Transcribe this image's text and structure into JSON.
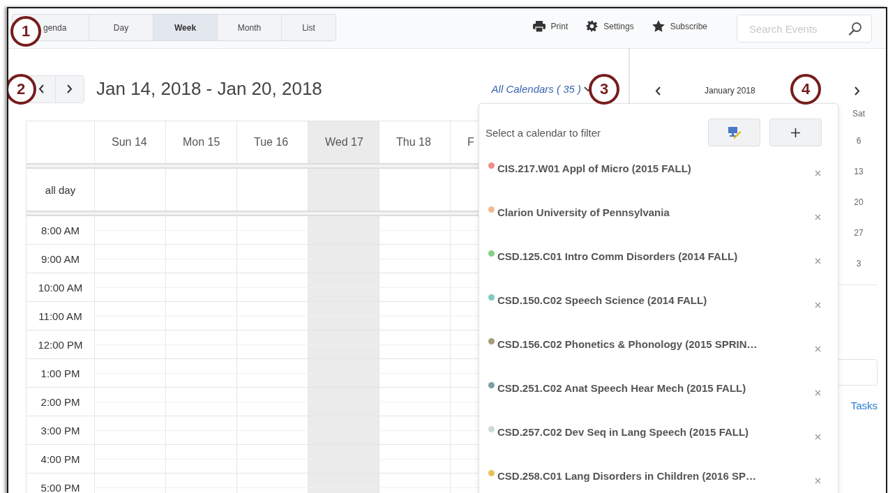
{
  "toolbar": {
    "view_tabs": [
      {
        "label": "genda",
        "selected": false
      },
      {
        "label": "Day",
        "selected": false
      },
      {
        "label": "Week",
        "selected": true
      },
      {
        "label": "Month",
        "selected": false
      },
      {
        "label": "List",
        "selected": false
      }
    ],
    "actions": [
      {
        "kind": "print",
        "label": "Print"
      },
      {
        "kind": "settings",
        "label": "Settings"
      },
      {
        "kind": "subscribe",
        "label": "Subscribe"
      }
    ],
    "search": {
      "placeholder": "Search Events"
    }
  },
  "week_view": {
    "date_range": "Jan 14, 2018 - Jan 20, 2018",
    "calendar_filter": "All Calendars ( 35 )",
    "all_day_label": "all day",
    "days": [
      {
        "label": "Sun 14",
        "highlighted": false
      },
      {
        "label": "Mon 15",
        "highlighted": false
      },
      {
        "label": "Tue 16",
        "highlighted": false
      },
      {
        "label": "Wed 17",
        "highlighted": true
      },
      {
        "label": "Thu 18",
        "highlighted": false
      },
      {
        "label": "F",
        "highlighted": false
      }
    ],
    "hours": [
      "8:00 AM",
      "9:00 AM",
      "10:00 AM",
      "11:00 AM",
      "12:00 PM",
      "1:00 PM",
      "2:00 PM",
      "3:00 PM",
      "4:00 PM",
      "5:00 PM"
    ]
  },
  "mini_calendar": {
    "month": "January 2018",
    "weekday": "Sat",
    "dates": [
      "6",
      "13",
      "20",
      "27",
      "3"
    ]
  },
  "sidebar_link": "Tasks",
  "calendar_dropdown": {
    "prompt": "Select a calendar to filter",
    "calendars": [
      {
        "name": "CIS.217.W01 Appl of Micro (2015 FALL)",
        "color": "#f08c8c"
      },
      {
        "name": "Clarion University of Pennsylvania",
        "color": "#f3b98f"
      },
      {
        "name": "CSD.125.C01 Intro Comm Disorders (2014 FALL)",
        "color": "#86cf86"
      },
      {
        "name": "CSD.150.C02 Speech Science (2014 FALL)",
        "color": "#7ccbc2"
      },
      {
        "name": "CSD.156.C02 Phonetics & Phonology (2015 SPRIN…",
        "color": "#a89b7c"
      },
      {
        "name": "CSD.251.C02 Anat Speech Hear Mech (2015 FALL)",
        "color": "#7f9ca8"
      },
      {
        "name": "CSD.257.C02 Dev Seq in Lang Speech (2015 FALL)",
        "color": "#c9ddd3"
      },
      {
        "name": "CSD.258.C01 Lang Disorders in Children (2016 SP…",
        "color": "#e6c15a"
      }
    ]
  },
  "callouts": [
    "1",
    "2",
    "3",
    "4"
  ]
}
